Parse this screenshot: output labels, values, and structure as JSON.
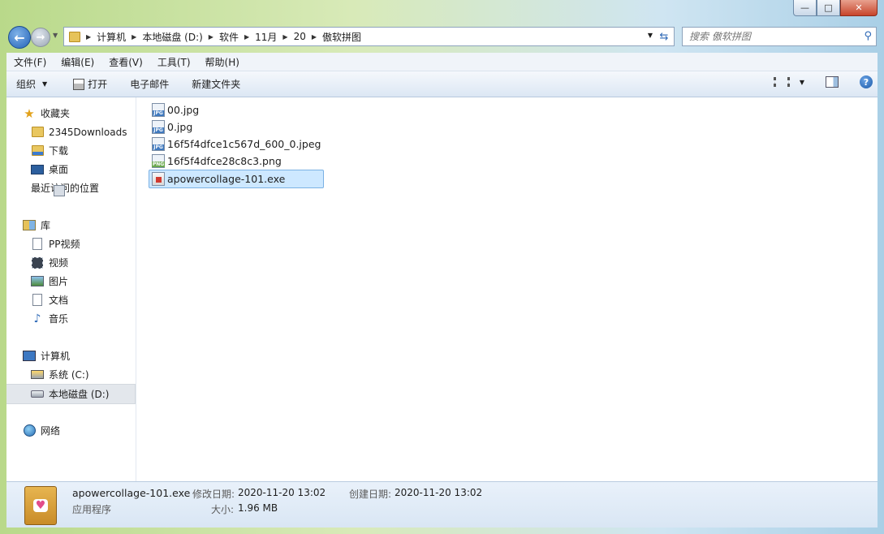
{
  "window": {
    "minimize": "—",
    "maximize": "□",
    "close": "✕"
  },
  "nav": {
    "back": "←",
    "forward": "→",
    "breadcrumb": [
      "计算机",
      "本地磁盘 (D:)",
      "软件",
      "11月",
      "20",
      "傲软拼图"
    ],
    "search_placeholder": "搜索 傲软拼图"
  },
  "menu": [
    "文件(F)",
    "编辑(E)",
    "查看(V)",
    "工具(T)",
    "帮助(H)"
  ],
  "commands": {
    "organize": "组织",
    "print": "打开",
    "email": "电子邮件",
    "new_folder": "新建文件夹",
    "help": "?"
  },
  "sidebar": {
    "favorites": {
      "label": "收藏夹",
      "items": [
        "2345Downloads",
        "下载",
        "桌面",
        "最近访问的位置"
      ]
    },
    "libraries": {
      "label": "库",
      "items": [
        "PP视频",
        "视频",
        "图片",
        "文档",
        "音乐"
      ]
    },
    "computer": {
      "label": "计算机",
      "items": [
        "系统 (C:)",
        "本地磁盘 (D:)"
      ]
    },
    "network": {
      "label": "网络"
    }
  },
  "files": [
    {
      "name": "00.jpg",
      "type": "jpg",
      "badge": "JPG"
    },
    {
      "name": "0.jpg",
      "type": "jpg",
      "badge": "JPG"
    },
    {
      "name": "16f5f4dfce1c567d_600_0.jpeg",
      "type": "jpg",
      "badge": "JPG"
    },
    {
      "name": "16f5f4dfce28c8c3.png",
      "type": "png",
      "badge": "PNG"
    },
    {
      "name": "apowercollage-101.exe",
      "type": "exe",
      "badge": "",
      "selected": true
    }
  ],
  "details": {
    "filename": "apowercollage-101.exe",
    "filetype": "应用程序",
    "modified_label": "修改日期:",
    "modified_value": "2020-11-20 13:02",
    "size_label": "大小:",
    "size_value": "1.96 MB",
    "created_label": "创建日期:",
    "created_value": "2020-11-20 13:02"
  }
}
